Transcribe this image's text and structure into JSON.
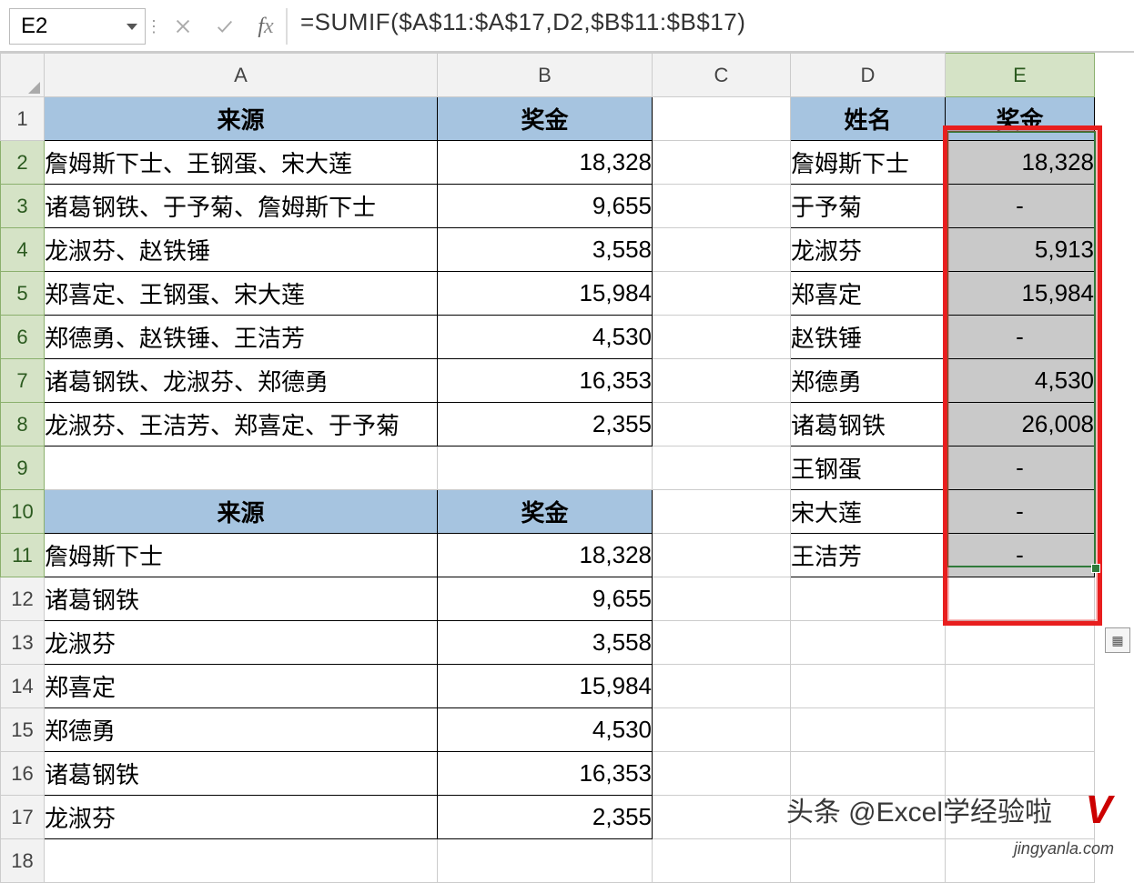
{
  "nameBox": "E2",
  "formula": "=SUMIF($A$11:$A$17,D2,$B$11:$B$17)",
  "colHeaders": [
    "A",
    "B",
    "C",
    "D",
    "E"
  ],
  "rows": [
    {
      "n": "1",
      "A": "来源",
      "B": "奖金",
      "C": "",
      "D": "姓名",
      "E": "奖金",
      "styleA": "hdrcell bord",
      "styleB": "hdrcell bord",
      "styleD": "hdrcell bord",
      "styleE": "hdrcell bord"
    },
    {
      "n": "2",
      "A": "詹姆斯下士、王钢蛋、宋大莲",
      "B": "18,328",
      "C": "",
      "D": "詹姆斯下士",
      "E": "18,328",
      "styleA": "bord txt-left",
      "styleB": "bord txt-right",
      "styleD": "bord txt-left",
      "styleE": "bord txt-right grayfill"
    },
    {
      "n": "3",
      "A": "诸葛钢铁、于予菊、詹姆斯下士",
      "B": "9,655",
      "C": "",
      "D": "于予菊",
      "E": "-",
      "styleA": "bord txt-left",
      "styleB": "bord txt-right",
      "styleD": "bord txt-left",
      "styleE": "bord txt-center grayfill"
    },
    {
      "n": "4",
      "A": "龙淑芬、赵铁锤",
      "B": "3,558",
      "C": "",
      "D": "龙淑芬",
      "E": "5,913",
      "styleA": "bord txt-left",
      "styleB": "bord txt-right",
      "styleD": "bord txt-left",
      "styleE": "bord txt-right grayfill"
    },
    {
      "n": "5",
      "A": "郑喜定、王钢蛋、宋大莲",
      "B": "15,984",
      "C": "",
      "D": "郑喜定",
      "E": "15,984",
      "styleA": "bord txt-left",
      "styleB": "bord txt-right",
      "styleD": "bord txt-left",
      "styleE": "bord txt-right grayfill"
    },
    {
      "n": "6",
      "A": "郑德勇、赵铁锤、王洁芳",
      "B": "4,530",
      "C": "",
      "D": "赵铁锤",
      "E": "-",
      "styleA": "bord txt-left",
      "styleB": "bord txt-right",
      "styleD": "bord txt-left",
      "styleE": "bord txt-center grayfill"
    },
    {
      "n": "7",
      "A": "诸葛钢铁、龙淑芬、郑德勇",
      "B": "16,353",
      "C": "",
      "D": "郑德勇",
      "E": "4,530",
      "styleA": "bord txt-left",
      "styleB": "bord txt-right",
      "styleD": "bord txt-left",
      "styleE": "bord txt-right grayfill"
    },
    {
      "n": "8",
      "A": "龙淑芬、王洁芳、郑喜定、于予菊",
      "B": "2,355",
      "C": "",
      "D": "诸葛钢铁",
      "E": "26,008",
      "styleA": "bord txt-left",
      "styleB": "bord txt-right",
      "styleD": "bord txt-left",
      "styleE": "bord txt-right grayfill"
    },
    {
      "n": "9",
      "A": "",
      "B": "",
      "C": "",
      "D": "王钢蛋",
      "E": "-",
      "styleD": "bord txt-left",
      "styleE": "bord txt-center grayfill"
    },
    {
      "n": "10",
      "A": "来源",
      "B": "奖金",
      "C": "",
      "D": "宋大莲",
      "E": "-",
      "styleA": "hdrcell bord",
      "styleB": "hdrcell bord",
      "styleD": "bord txt-left",
      "styleE": "bord txt-center grayfill"
    },
    {
      "n": "11",
      "A": "詹姆斯下士",
      "B": "18,328",
      "C": "",
      "D": "王洁芳",
      "E": "-",
      "styleA": "bord txt-left",
      "styleB": "bord txt-right",
      "styleD": "bord txt-left",
      "styleE": "bord txt-center grayfill"
    },
    {
      "n": "12",
      "A": "诸葛钢铁",
      "B": "9,655",
      "C": "",
      "D": "",
      "E": "",
      "styleA": "bord txt-left",
      "styleB": "bord txt-right"
    },
    {
      "n": "13",
      "A": "龙淑芬",
      "B": "3,558",
      "C": "",
      "D": "",
      "E": "",
      "styleA": "bord txt-left",
      "styleB": "bord txt-right"
    },
    {
      "n": "14",
      "A": "郑喜定",
      "B": "15,984",
      "C": "",
      "D": "",
      "E": "",
      "styleA": "bord txt-left",
      "styleB": "bord txt-right"
    },
    {
      "n": "15",
      "A": "郑德勇",
      "B": "4,530",
      "C": "",
      "D": "",
      "E": "",
      "styleA": "bord txt-left",
      "styleB": "bord txt-right"
    },
    {
      "n": "16",
      "A": "诸葛钢铁",
      "B": "16,353",
      "C": "",
      "D": "",
      "E": "",
      "styleA": "bord txt-left",
      "styleB": "bord txt-right"
    },
    {
      "n": "17",
      "A": "龙淑芬",
      "B": "2,355",
      "C": "",
      "D": "",
      "E": "",
      "styleA": "bord txt-left",
      "styleB": "bord txt-right"
    },
    {
      "n": "18",
      "A": "",
      "B": "",
      "C": "",
      "D": "",
      "E": ""
    }
  ],
  "watermark1": "头条 @Excel学经验啦",
  "watermark2": "jingyanla.com",
  "vmark": "V"
}
